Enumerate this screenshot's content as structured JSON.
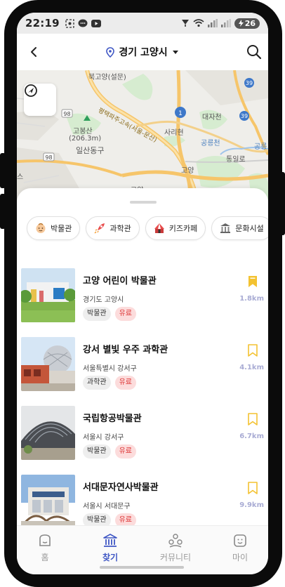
{
  "status_bar": {
    "time": "22:19",
    "battery": "26"
  },
  "header": {
    "location": "경기 고양시"
  },
  "map": {
    "labels": {
      "bukgoyang": "북고양(설문)",
      "highway": "평택파주고속(서울-문산)",
      "mountain": "고봉산",
      "elevation": "(206.3m)",
      "district": "일산동구",
      "sarihyeon": "사리현",
      "daejacheon": "대자천",
      "gongneungcheon": "공릉천",
      "tongillo": "통일로",
      "gong": "공릉",
      "goyang_jc": "고양",
      "goyang_ic": "고양",
      "seu": "스"
    },
    "route_numbers": [
      "1",
      "39",
      "39",
      "98",
      "98"
    ]
  },
  "categories": [
    {
      "label": "박물관",
      "icon": "museum-baby-icon"
    },
    {
      "label": "과학관",
      "icon": "rocket-icon"
    },
    {
      "label": "키즈카페",
      "icon": "circus-tent-icon"
    },
    {
      "label": "문화시설",
      "icon": "building-columns-icon"
    }
  ],
  "places": [
    {
      "title": "고양 어린이 박물관",
      "address": "경기도 고양시",
      "category": "박물관",
      "fee": "유료",
      "distance": "1.8km",
      "bookmarked": true
    },
    {
      "title": "강서 별빛 우주 과학관",
      "address": "서울특별시 강서구",
      "category": "과학관",
      "fee": "유료",
      "distance": "4.1km",
      "bookmarked": false
    },
    {
      "title": "국립항공박물관",
      "address": "서울시 강서구",
      "category": "박물관",
      "fee": "유료",
      "distance": "6.7km",
      "bookmarked": false
    },
    {
      "title": "서대문자연사박물관",
      "address": "서울시 서대문구",
      "category": "박물관",
      "fee": "유료",
      "distance": "9.9km",
      "bookmarked": false
    }
  ],
  "nav": [
    {
      "label": "홈",
      "icon": "home-icon"
    },
    {
      "label": "찾기",
      "icon": "museum-icon"
    },
    {
      "label": "커뮤니티",
      "icon": "community-icon"
    },
    {
      "label": "마이",
      "icon": "smile-icon"
    }
  ],
  "colors": {
    "accent": "#3e56c4",
    "bookmark": "#f3c231",
    "distance": "#a9acd4",
    "fee_tag_bg": "#fcdcdc",
    "fee_tag_text": "#dd3333"
  }
}
